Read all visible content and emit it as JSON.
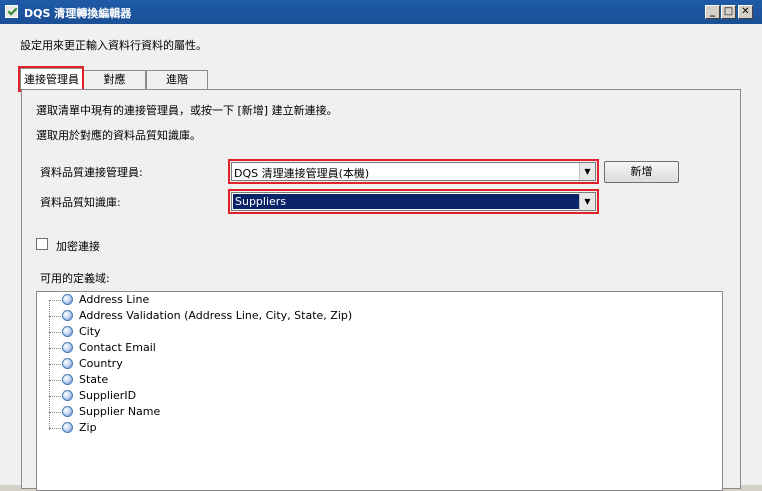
{
  "window": {
    "title": "DQS 清理轉換編輯器",
    "minimize": "_",
    "maximize": "□",
    "close": "✕"
  },
  "description": "設定用來更正輸入資料行資料的屬性。",
  "tabs": [
    {
      "label": "連接管理員",
      "active": true
    },
    {
      "label": "對應",
      "active": false
    },
    {
      "label": "進階",
      "active": false
    }
  ],
  "panel": {
    "line1": "選取清單中現有的連接管理員，或按一下 [新增] 建立新連接。",
    "line2": "選取用於對應的資料品質知識庫。",
    "connection_manager_label": "資料品質連接管理員:",
    "connection_manager_value": "DQS 清理連接管理員(本機)",
    "new_button": "新增",
    "knowledge_base_label": "資料品質知識庫:",
    "knowledge_base_value": "Suppliers",
    "encrypt_label": "加密連接",
    "encrypt_checked": false,
    "domains_label": "可用的定義域:",
    "domains": [
      "Address Line",
      "Address Validation  (Address Line, City, State, Zip)",
      "City",
      "Contact Email",
      "Country",
      "State",
      "SupplierID",
      "Supplier Name",
      "Zip"
    ]
  },
  "colors": {
    "titlebar": "#1f5ba8",
    "highlight": "#e0202a",
    "selection": "#0a246a"
  }
}
